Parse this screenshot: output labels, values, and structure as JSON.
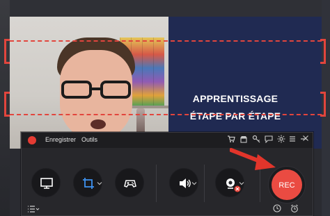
{
  "video": {
    "promo_line1": "APPRENTISSAGE",
    "promo_line2": "ÉTAPE PAR ÉTAPE"
  },
  "recorder": {
    "menu": {
      "record_label": "Enregistrer",
      "tools_label": "Outils"
    },
    "rec_label": "REC",
    "colors": {
      "accent": "#ea4b42",
      "panel": "#27272b",
      "titlebar": "#1d1d20"
    },
    "titlebar_icons": [
      "cart-icon",
      "shop-icon",
      "key-icon",
      "chat-icon",
      "settings-icon",
      "menu-icon",
      "minimize-icon",
      "close-icon"
    ],
    "controls": [
      "monitor-icon",
      "crop-region-icon",
      "gamepad-icon",
      "speaker-icon",
      "webcam-icon"
    ]
  },
  "annotation": {
    "arrow_color": "#e2352b"
  }
}
